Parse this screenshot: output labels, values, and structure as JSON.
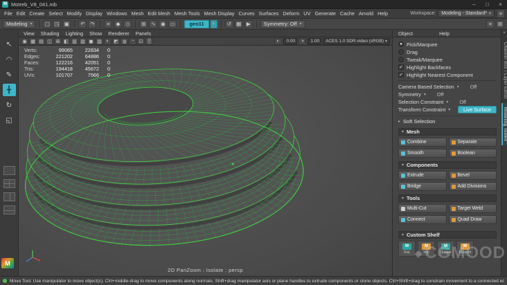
{
  "glyphs": {
    "caret": "▾",
    "caret_right": "▸",
    "check": "✓",
    "radio_on": "●",
    "close": "×",
    "minimize": "–",
    "maximize": "□",
    "menu": "≡",
    "diamond": "◆"
  },
  "window": {
    "logo": "M",
    "title": "Motreb_V8_041.mb"
  },
  "menu_bar": {
    "items": [
      "File",
      "Edit",
      "Create",
      "Select",
      "Modify",
      "Display",
      "Windows",
      "Mesh",
      "Edit Mesh",
      "Mesh Tools",
      "Mesh Display",
      "Curves",
      "Surfaces",
      "Deform",
      "UV",
      "Generate",
      "Cache",
      "Arnold",
      "Help"
    ],
    "workspace_label": "Workspace:",
    "workspace_value": "Modeling - Standard*"
  },
  "shelf": {
    "mode": "Modeling",
    "icons": [
      {
        "name": "new-scene-icon",
        "glyph": "▢"
      },
      {
        "name": "open-scene-icon",
        "glyph": "◳"
      },
      {
        "name": "save-scene-icon",
        "glyph": "▣"
      },
      {
        "name": "undo-icon",
        "glyph": "↶"
      },
      {
        "name": "redo-icon",
        "glyph": "↷"
      },
      {
        "name": "select-hierarchy-icon",
        "glyph": "≡"
      },
      {
        "name": "select-object-icon",
        "glyph": "◆"
      },
      {
        "name": "select-component-icon",
        "glyph": "◇"
      },
      {
        "name": "snap-grid-icon",
        "glyph": "⊞"
      },
      {
        "name": "snap-curve-icon",
        "glyph": "∿"
      },
      {
        "name": "snap-point-icon",
        "glyph": "◉"
      },
      {
        "name": "snap-plane-icon",
        "glyph": "▭"
      }
    ],
    "live_object": "geo11",
    "post_icons": [
      {
        "name": "construction-history-icon",
        "glyph": "↺"
      },
      {
        "name": "render-icon",
        "glyph": "▦"
      },
      {
        "name": "ipr-render-icon",
        "glyph": "▶"
      }
    ],
    "symmetry": "Symmetry: Off",
    "right_icons": [
      {
        "name": "shelf-menu-icon",
        "glyph": "≡"
      },
      {
        "name": "shelf-grid-icon",
        "glyph": "⊞"
      }
    ]
  },
  "toolbox": {
    "tools": [
      {
        "name": "select-tool",
        "glyph": "↖"
      },
      {
        "name": "lasso-tool",
        "glyph": "◠"
      },
      {
        "name": "paint-select-tool",
        "glyph": "✎"
      },
      {
        "name": "move-tool",
        "glyph": "╋"
      },
      {
        "name": "rotate-tool",
        "glyph": "↻"
      },
      {
        "name": "scale-tool",
        "glyph": "◱"
      }
    ]
  },
  "panel_menu": {
    "items": [
      "View",
      "Shading",
      "Lighting",
      "Show",
      "Renderer",
      "Panels"
    ]
  },
  "viewport_toolbar": {
    "icons": [
      {
        "name": "lock-camera-icon",
        "glyph": "◉"
      },
      {
        "name": "camera-attributes-icon",
        "glyph": "▦"
      },
      {
        "name": "bookmark-icon",
        "glyph": "▤"
      },
      {
        "name": "image-plane-icon",
        "glyph": "◫"
      },
      {
        "name": "2d-pan-zoom-icon",
        "glyph": "⊞"
      },
      {
        "name": "isolate-select-icon",
        "glyph": "◧"
      },
      {
        "name": "xray-icon",
        "glyph": "▥"
      },
      {
        "name": "wireframe-icon",
        "glyph": "▧"
      },
      {
        "name": "shaded-icon",
        "glyph": "◼"
      },
      {
        "name": "textured-icon",
        "glyph": "▨"
      },
      {
        "name": "lighting-icon",
        "glyph": "◐"
      },
      {
        "name": "shadows-icon",
        "glyph": "◩"
      },
      {
        "name": "ambient-occlusion-icon",
        "glyph": "◍"
      },
      {
        "name": "motion-blur-icon",
        "glyph": "◔"
      },
      {
        "name": "multisample-icon",
        "glyph": "⊡"
      },
      {
        "name": "fog-icon",
        "glyph": "▒"
      }
    ],
    "exposure": "0.00",
    "gamma": "1.00",
    "colorspace": "ACES 1.0 SDR-video (sRGB)"
  },
  "hud": {
    "rows": [
      {
        "label": "Verts:",
        "v1": "99065",
        "v2": "22834",
        "v3": "0"
      },
      {
        "label": "Edges:",
        "v1": "221202",
        "v2": "64886",
        "v3": "0"
      },
      {
        "label": "Faces:",
        "v1": "122216",
        "v2": "42051",
        "v3": "0"
      },
      {
        "label": "Tris:",
        "v1": "194418",
        "v2": "45672",
        "v3": "0"
      },
      {
        "label": "UVs:",
        "v1": "101707",
        "v2": "7566",
        "v3": "0"
      }
    ]
  },
  "viewport": {
    "footer": "2D PanZoom : Isolate : persp",
    "colors": {
      "wire": "#3ed43e",
      "wire_dim": "#2fa944",
      "surface": "#535353",
      "hole": "#484848"
    }
  },
  "right_panel": {
    "menu_object": "Object",
    "menu_help": "Help",
    "radios": [
      {
        "label": "Pick/Marquee",
        "glyph": "●"
      },
      {
        "label": "Drag",
        "glyph": ""
      },
      {
        "label": "Tweak/Marquee",
        "glyph": ""
      }
    ],
    "checks": [
      {
        "label": "Highlight Backfaces",
        "glyph": "✓"
      },
      {
        "label": "Highlight Nearest Component",
        "glyph": "✓"
      }
    ],
    "drops": [
      {
        "label": "Camera Based Selection",
        "value": "Off"
      },
      {
        "label": "Symmetry",
        "value": "Off"
      },
      {
        "label": "Selection Constraint",
        "value": "Off"
      }
    ],
    "transform_constraint": {
      "label": "Transform Constraint",
      "value": "Live Surface"
    },
    "soft_selection": "Soft Selection",
    "sections": [
      {
        "title": "Mesh",
        "buttons": [
          {
            "label": "Combine",
            "icon": "#56c2d6"
          },
          {
            "label": "Separate",
            "icon": "#e09a3c"
          },
          {
            "label": "Smooth",
            "icon": "#56c2d6"
          },
          {
            "label": "Boolean",
            "icon": "#e09a3c"
          }
        ]
      },
      {
        "title": "Components",
        "buttons": [
          {
            "label": "Extrude",
            "icon": "#56c2d6"
          },
          {
            "label": "Bevel",
            "icon": "#e09a3c"
          },
          {
            "label": "Bridge",
            "icon": "#56c2d6"
          },
          {
            "label": "Add Divisions",
            "icon": "#e09a3c"
          }
        ]
      },
      {
        "title": "Tools",
        "buttons": [
          {
            "label": "Multi-Cut",
            "icon": "#cfcfcf"
          },
          {
            "label": "Target Weld",
            "icon": "#e09a3c"
          },
          {
            "label": "Connect",
            "icon": "#56c2d6"
          },
          {
            "label": "Quad Draw",
            "icon": "#e09a3c"
          }
        ]
      }
    ],
    "custom_shelf": {
      "title": "Custom Shelf",
      "items": [
        {
          "label": "Exp",
          "logo": "M",
          "icon": "#2ba8a0"
        },
        {
          "label": "Imp",
          "logo": "M",
          "icon": "#e09a3c"
        },
        {
          "label": "Update",
          "logo": "M",
          "icon": "#2ba8a0"
        },
        {
          "label": "BExport",
          "logo": "M",
          "icon": "#e09a3c"
        }
      ]
    }
  },
  "side_tabs": [
    {
      "label": "Channel Box / Layer Editor"
    },
    {
      "label": "Modeling Toolkit"
    }
  ],
  "status_bar": {
    "help": "Move Tool: Use manipulator to move object(s). Ctrl+middle-drag to move components along normals. Shift+drag manipulator axis or plane handles to extrude components or clone objects. Ctrl+Shift+drag to constrain movement to a connected edge. Use D or INSERT to change"
  },
  "watermark": {
    "text": "CGMOOD",
    "logo": "M"
  },
  "colors": {
    "accent": "#3eb6c8",
    "wire_green": "#3ed43e",
    "orange": "#e09a3c"
  }
}
